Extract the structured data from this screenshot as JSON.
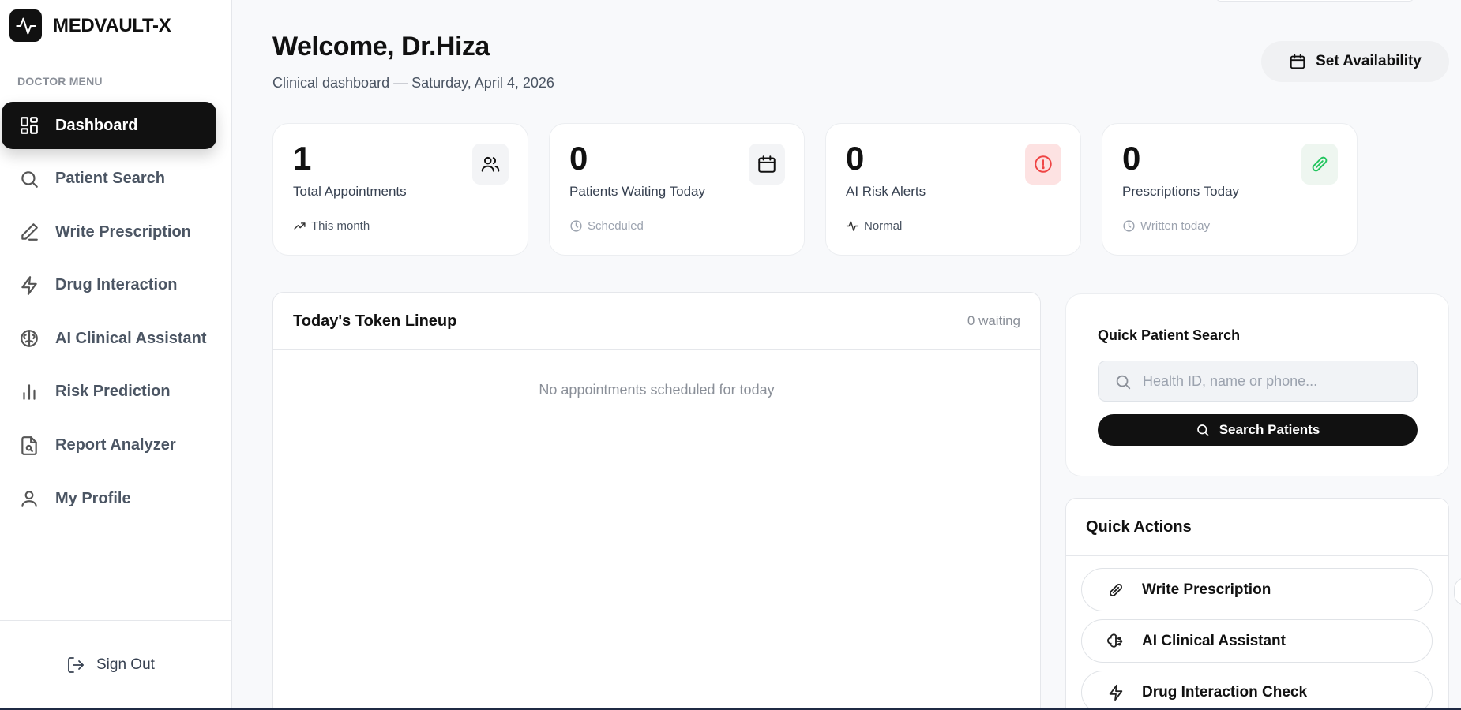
{
  "brand": {
    "name": "MEDVAULT-X",
    "logo_icon": "pulse-icon"
  },
  "sidebar": {
    "section_label": "DOCTOR MENU",
    "items": [
      {
        "label": "Dashboard",
        "icon": "dashboard-icon",
        "active": true
      },
      {
        "label": "Patient Search",
        "icon": "search-icon"
      },
      {
        "label": "Write Prescription",
        "icon": "pen-icon"
      },
      {
        "label": "Drug Interaction",
        "icon": "bolt-icon"
      },
      {
        "label": "AI Clinical Assistant",
        "icon": "brain-icon"
      },
      {
        "label": "Risk Prediction",
        "icon": "bar-chart-icon"
      },
      {
        "label": "Report Analyzer",
        "icon": "file-search-icon"
      },
      {
        "label": "My Profile",
        "icon": "user-icon"
      }
    ],
    "sign_out": "Sign Out"
  },
  "header": {
    "title": "Welcome, Dr.Hiza",
    "subtitle": "Clinical dashboard — Saturday, April 4, 2026",
    "availability_button": "Set Availability"
  },
  "stats": [
    {
      "value": "1",
      "label": "Total Appointments",
      "footer": "This month",
      "icon": "users-icon"
    },
    {
      "value": "0",
      "label": "Patients Waiting Today",
      "footer": "Scheduled",
      "icon": "calendar-icon"
    },
    {
      "value": "0",
      "label": "AI Risk Alerts",
      "footer": "Normal",
      "icon": "alert-circle-icon"
    },
    {
      "value": "0",
      "label": "Prescriptions Today",
      "footer": "Written today",
      "icon": "pill-icon"
    }
  ],
  "lineup": {
    "title": "Today's Token Lineup",
    "count": "0 waiting",
    "empty_text": "No appointments scheduled for today"
  },
  "quick_search": {
    "title": "Quick Patient Search",
    "placeholder": "Health ID, name or phone...",
    "value": "",
    "button": "Search Patients"
  },
  "quick_actions": {
    "title": "Quick Actions",
    "items": [
      {
        "label": "Write Prescription",
        "icon": "pill-icon"
      },
      {
        "label": "AI Clinical Assistant",
        "icon": "brain-icon"
      },
      {
        "label": "Drug Interaction Check",
        "icon": "bolt-icon"
      }
    ]
  },
  "colors": {
    "accent": "#111111",
    "alert_red": "#ef4444",
    "success_green": "#22c55e",
    "background": "#f8f9fb"
  }
}
